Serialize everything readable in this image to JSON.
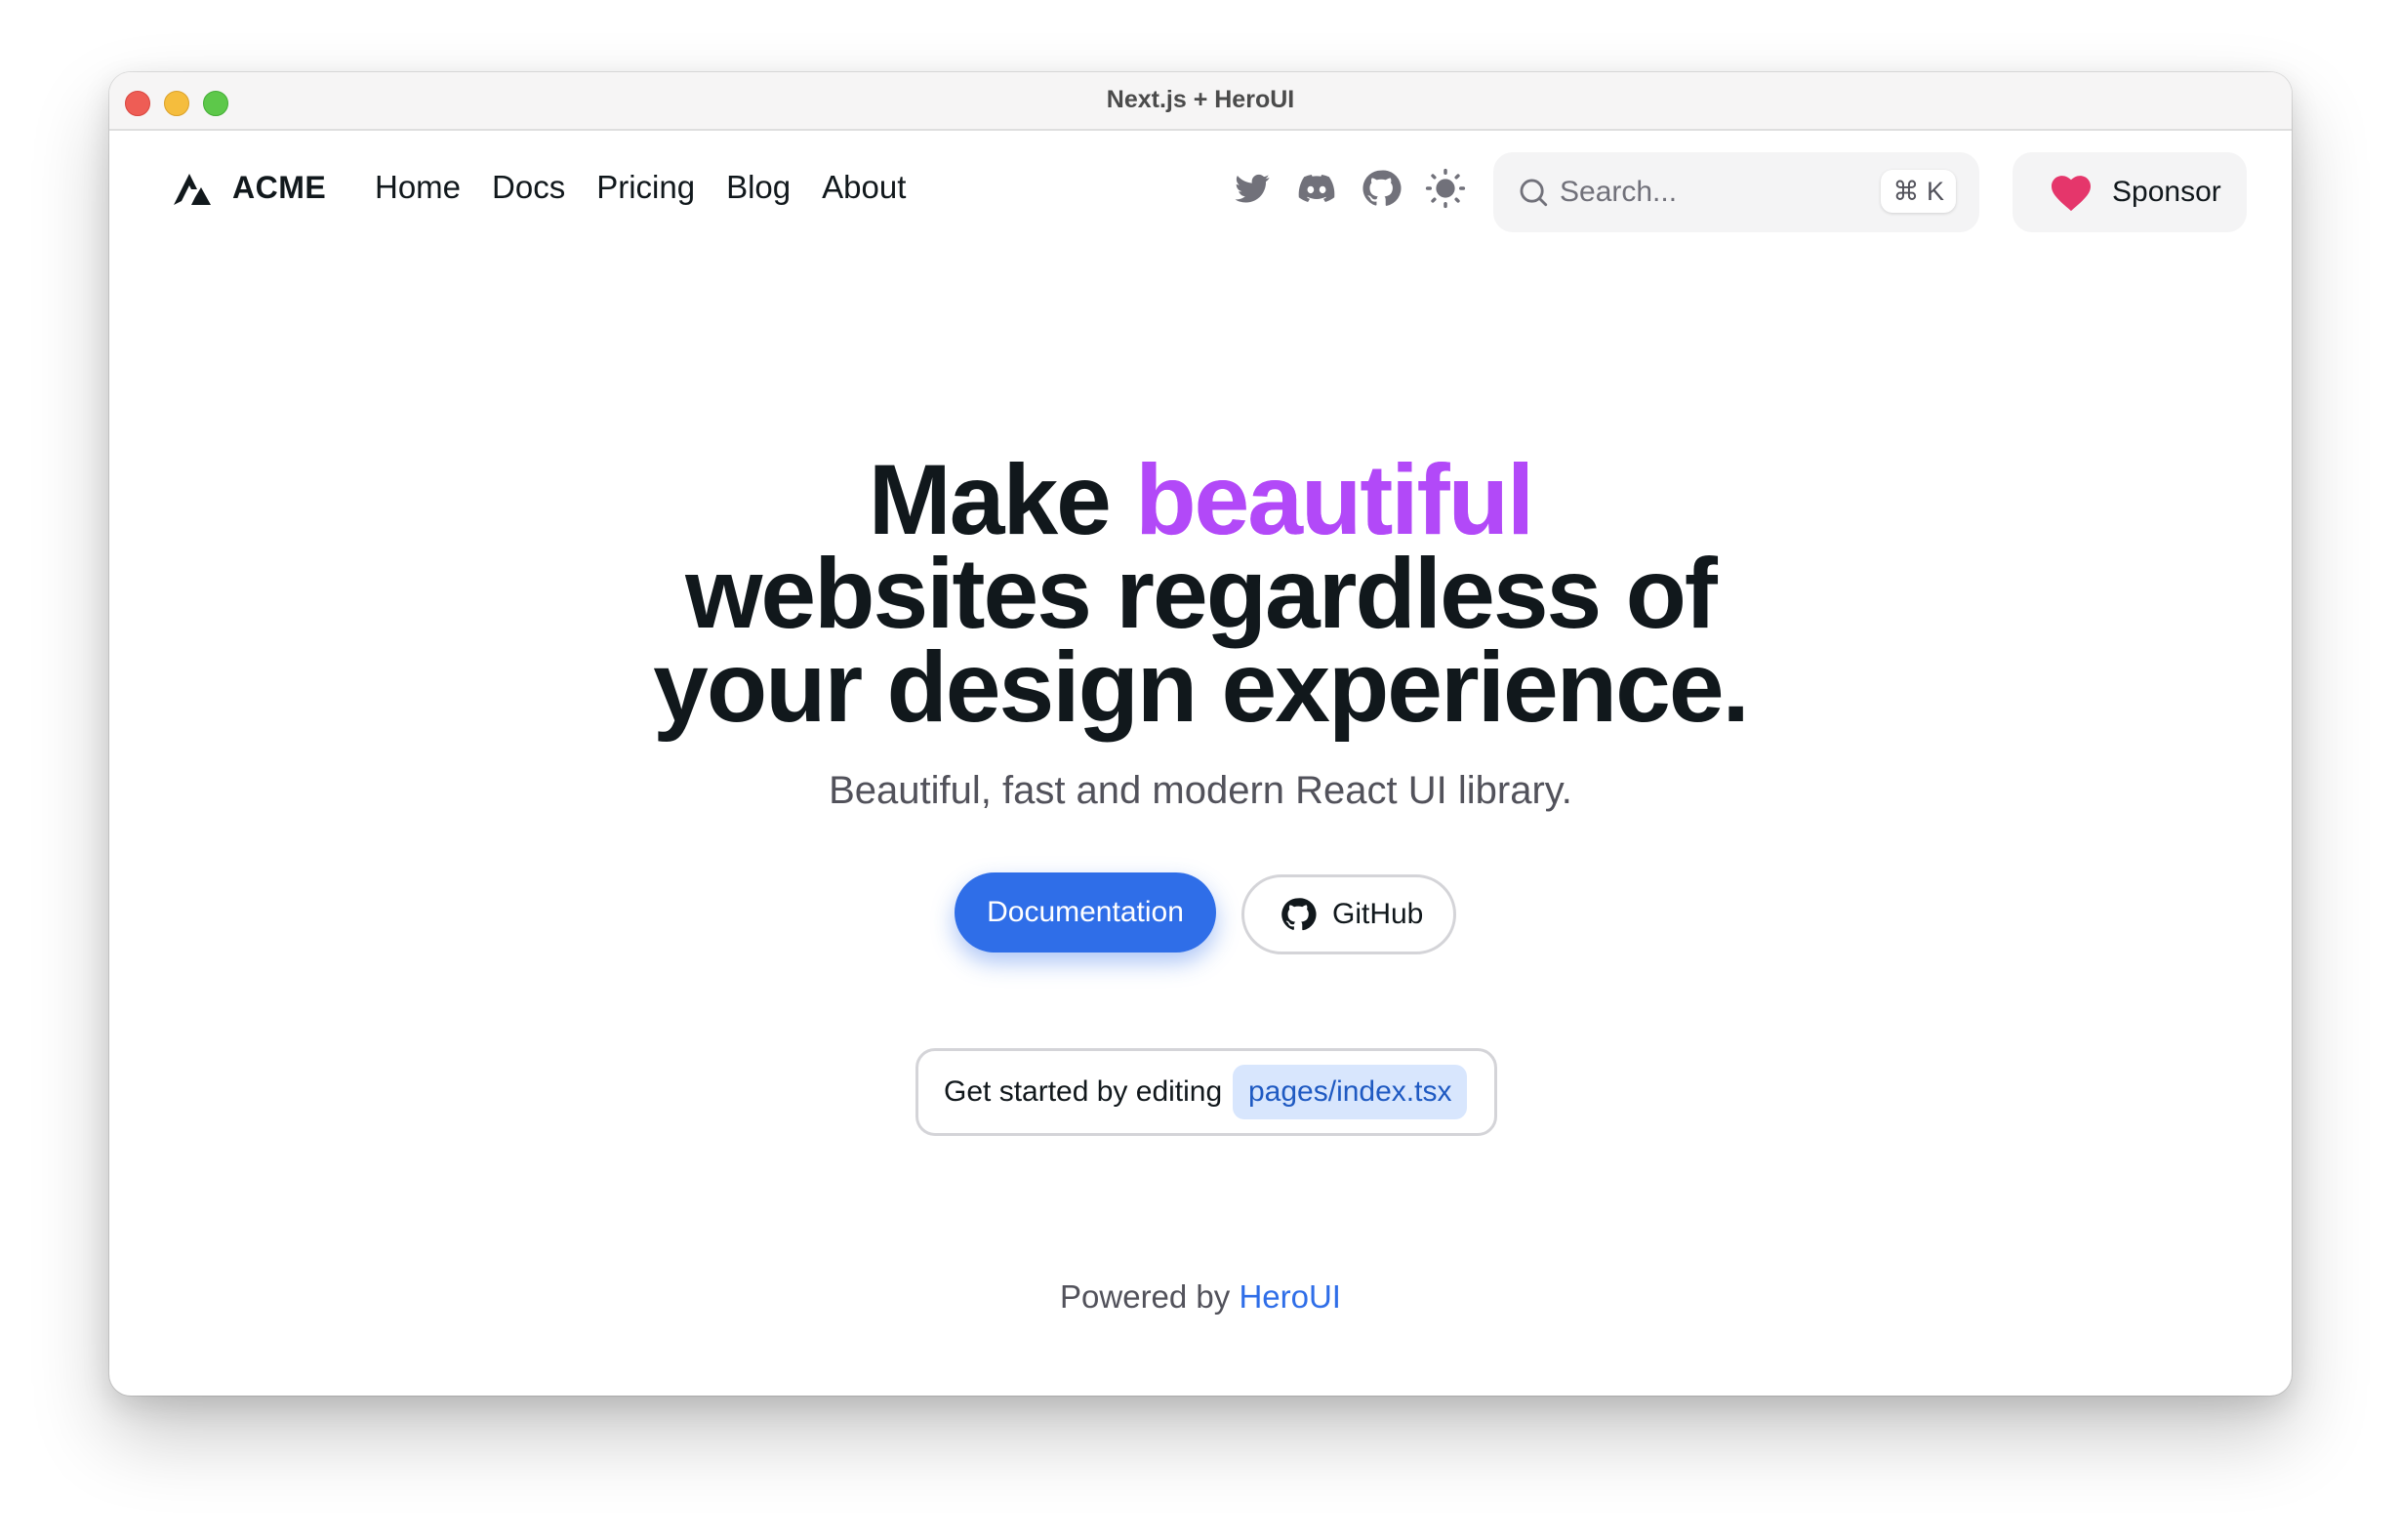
{
  "window": {
    "title": "Next.js + HeroUI"
  },
  "navbar": {
    "brand": "ACME",
    "links": [
      "Home",
      "Docs",
      "Pricing",
      "Blog",
      "About"
    ],
    "icons": [
      "twitter-icon",
      "discord-icon",
      "github-icon",
      "theme-toggle-icon"
    ],
    "search": {
      "placeholder": "Search...",
      "shortcut": "⌘ K"
    },
    "sponsor": "Sponsor"
  },
  "hero": {
    "line1_prefix": "Make",
    "line1_accent": "beautiful",
    "line2": "websites regardless of",
    "line3": "your design experience.",
    "subtitle": "Beautiful, fast and modern React UI library.",
    "primary_button": "Documentation",
    "secondary_button": "GitHub",
    "snippet_text": "Get started by editing",
    "snippet_code": "pages/index.tsx"
  },
  "footer": {
    "prefix": "Powered by",
    "link": "HeroUI"
  },
  "colors": {
    "accent_gradient": "#b249f8",
    "primary": "#2f6ee8",
    "sponsor_heart": "#e5366b"
  }
}
